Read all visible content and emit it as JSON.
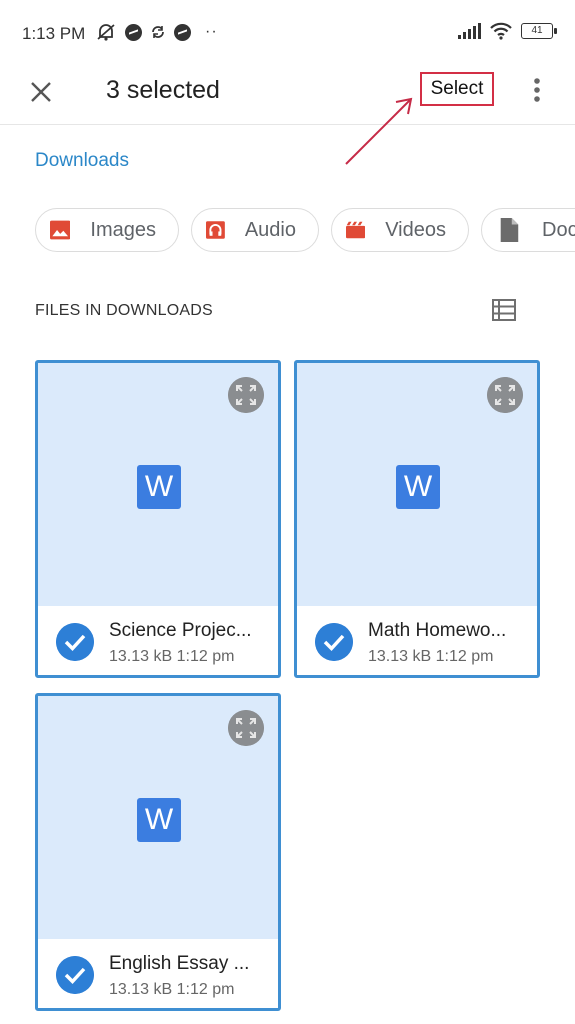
{
  "status_bar": {
    "time": "1:13 PM",
    "left_icons": [
      "muted-alarm-icon",
      "messenger-icon",
      "sync-icon",
      "messenger-icon",
      "more-notifications-icon"
    ],
    "more_notifications": "··",
    "right_icons": [
      "signal-icon",
      "wifi-icon",
      "battery-icon"
    ],
    "battery_level": "41"
  },
  "app_bar": {
    "close_icon": "close-icon",
    "title": "3 selected",
    "select_label": "Select",
    "more_icon": "more-vert-icon"
  },
  "annotation": {
    "highlight_color": "#d32f45",
    "target": "Select"
  },
  "breadcrumb": {
    "label": "Downloads",
    "color": "#2b87c8"
  },
  "categories": [
    {
      "label": "Images",
      "icon": "image-icon",
      "color": "#e04a36"
    },
    {
      "label": "Audio",
      "icon": "headphones-icon",
      "color": "#e04a36"
    },
    {
      "label": "Videos",
      "icon": "clapperboard-icon",
      "color": "#e04a36"
    },
    {
      "label": "Documents",
      "visible_label": "Doc",
      "icon": "document-icon",
      "color": "#6b6b6b"
    }
  ],
  "files_section": {
    "title": "FILES IN DOWNLOADS",
    "view_toggle_icon": "list-view-icon"
  },
  "files": [
    {
      "name": "Science Projec...",
      "size": "13.13 kB",
      "time": "1:12 pm",
      "selected": true,
      "type_label": "W"
    },
    {
      "name": "Math Homewo...",
      "size": "13.13 kB",
      "time": "1:12 pm",
      "selected": true,
      "type_label": "W"
    },
    {
      "name": "English Essay ...",
      "size": "13.13 kB",
      "time": "1:12 pm",
      "selected": true,
      "type_label": "W"
    }
  ],
  "colors": {
    "selection_border": "#3f8fd2",
    "selection_fill": "#dbeafb",
    "check": "#2d7fd6",
    "word_icon": "#3b7de0"
  }
}
